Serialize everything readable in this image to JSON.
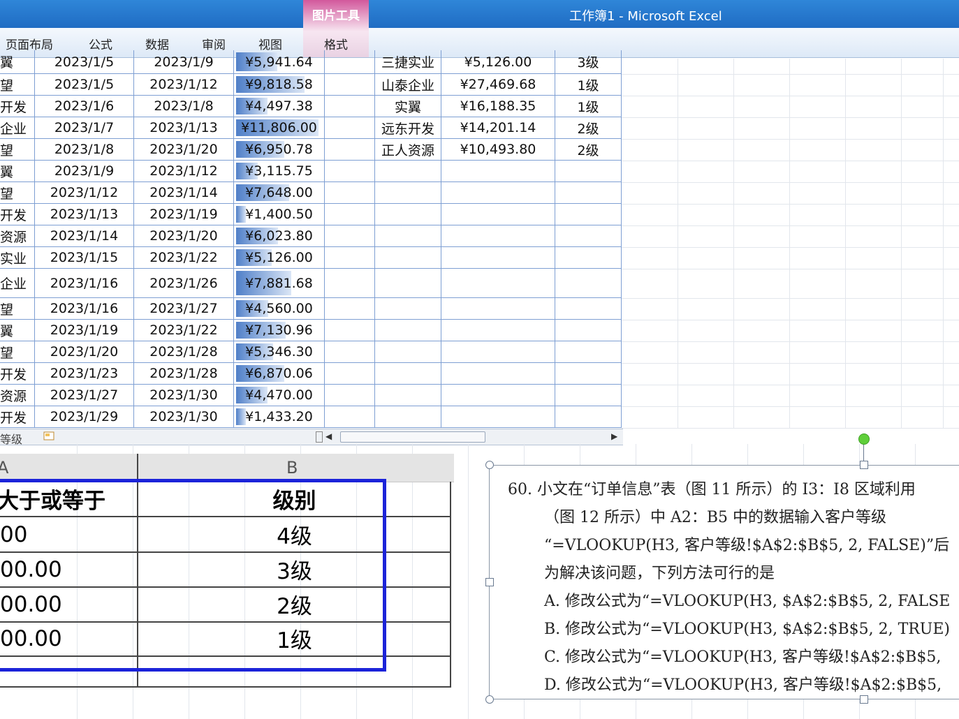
{
  "window": {
    "title": "工作簿1 - Microsoft Excel",
    "context_tab_group": "图片工具",
    "context_tab": "格式"
  },
  "ribbon_tabs": [
    "页面布局",
    "公式",
    "数据",
    "审阅",
    "视图"
  ],
  "orders": [
    {
      "customer": "翼",
      "order_date": "2023/1/5",
      "ship_date": "2023/1/9",
      "amount": "¥5,941.64",
      "amount_value": 5941.64
    },
    {
      "customer": "望",
      "order_date": "2023/1/5",
      "ship_date": "2023/1/12",
      "amount": "¥9,818.58",
      "amount_value": 9818.58
    },
    {
      "customer": "开发",
      "order_date": "2023/1/6",
      "ship_date": "2023/1/8",
      "amount": "¥4,497.38",
      "amount_value": 4497.38
    },
    {
      "customer": "企业",
      "order_date": "2023/1/7",
      "ship_date": "2023/1/13",
      "amount": "¥11,806.00",
      "amount_value": 11806.0
    },
    {
      "customer": "望",
      "order_date": "2023/1/8",
      "ship_date": "2023/1/20",
      "amount": "¥6,950.78",
      "amount_value": 6950.78
    },
    {
      "customer": "翼",
      "order_date": "2023/1/9",
      "ship_date": "2023/1/12",
      "amount": "¥3,115.75",
      "amount_value": 3115.75
    },
    {
      "customer": "望",
      "order_date": "2023/1/12",
      "ship_date": "2023/1/14",
      "amount": "¥7,648.00",
      "amount_value": 7648.0
    },
    {
      "customer": "开发",
      "order_date": "2023/1/13",
      "ship_date": "2023/1/19",
      "amount": "¥1,400.50",
      "amount_value": 1400.5
    },
    {
      "customer": "资源",
      "order_date": "2023/1/14",
      "ship_date": "2023/1/20",
      "amount": "¥6,023.80",
      "amount_value": 6023.8
    },
    {
      "customer": "实业",
      "order_date": "2023/1/15",
      "ship_date": "2023/1/22",
      "amount": "¥5,126.00",
      "amount_value": 5126.0
    },
    {
      "customer": "企业",
      "order_date": "2023/1/16",
      "ship_date": "2023/1/26",
      "amount": "¥7,881.68",
      "amount_value": 7881.68
    },
    {
      "customer": "望",
      "order_date": "2023/1/16",
      "ship_date": "2023/1/27",
      "amount": "¥4,560.00",
      "amount_value": 4560.0
    },
    {
      "customer": "翼",
      "order_date": "2023/1/19",
      "ship_date": "2023/1/22",
      "amount": "¥7,130.96",
      "amount_value": 7130.96
    },
    {
      "customer": "望",
      "order_date": "2023/1/20",
      "ship_date": "2023/1/28",
      "amount": "¥5,346.30",
      "amount_value": 5346.3
    },
    {
      "customer": "开发",
      "order_date": "2023/1/23",
      "ship_date": "2023/1/28",
      "amount": "¥6,870.06",
      "amount_value": 6870.06
    },
    {
      "customer": "资源",
      "order_date": "2023/1/27",
      "ship_date": "2023/1/30",
      "amount": "¥4,470.00",
      "amount_value": 4470.0
    },
    {
      "customer": "开发",
      "order_date": "2023/1/29",
      "ship_date": "2023/1/30",
      "amount": "¥1,433.20",
      "amount_value": 1433.2
    }
  ],
  "databar_max": 11806.0,
  "summary": [
    {
      "company": "三捷实业",
      "total": "¥5,126.00",
      "level": "3级"
    },
    {
      "company": "山泰企业",
      "total": "¥27,469.68",
      "level": "1级"
    },
    {
      "company": "实翼",
      "total": "¥16,188.35",
      "level": "1级"
    },
    {
      "company": "远东开发",
      "total": "¥14,201.14",
      "level": "2级"
    },
    {
      "company": "正人资源",
      "total": "¥10,493.80",
      "level": "2级"
    }
  ],
  "sheet_tab": "等级",
  "grade_table": {
    "col_a": "A",
    "col_b": "B",
    "header_a": "大于或等于",
    "header_b": "级别",
    "rows": [
      {
        "a": "00",
        "b": "4级"
      },
      {
        "a": "00.00",
        "b": "3级"
      },
      {
        "a": "00.00",
        "b": "2级"
      },
      {
        "a": "00.00",
        "b": "1级"
      }
    ]
  },
  "question": {
    "lines": [
      "60. 小文在“订单信息”表（图 11 所示）的 I3：I8 区域利用",
      "（图 12 所示）中 A2：B5 中的数据输入客户等级",
      "“=VLOOKUP(H3, 客户等级!$A$2:$B$5, 2, FALSE)”后",
      "为解决该问题，下列方法可行的是",
      "A. 修改公式为“=VLOOKUP(H3, $A$2:$B$5, 2, FALSE",
      "B. 修改公式为“=VLOOKUP(H3, $A$2:$B$5, 2, TRUE)",
      "C. 修改公式为“=VLOOKUP(H3, 客户等级!$A$2:$B$5,",
      "D. 修改公式为“=VLOOKUP(H3, 客户等级!$A$2:$B$5,"
    ]
  },
  "colors": {
    "accent": "#1b23d9",
    "databar": "#4f7fc8",
    "gridline": "#7e9fd3",
    "titlebar": "#2f86d8"
  }
}
